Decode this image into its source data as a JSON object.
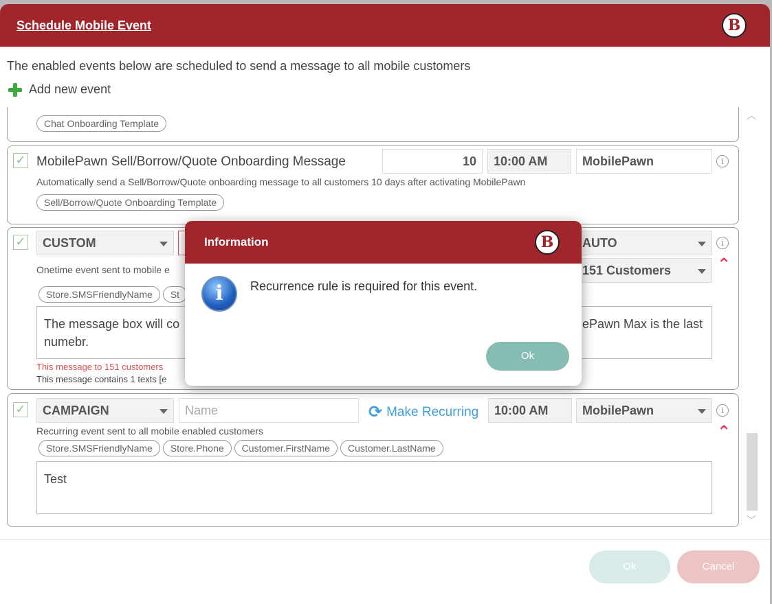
{
  "window": {
    "title": "Schedule Mobile Event",
    "intro": "The enabled events below are scheduled to send a message to all mobile customers",
    "add_new": "Add new event"
  },
  "colors": {
    "brand": "#a0262b",
    "ok_button": "#86bcb2",
    "add_icon": "#3daa3d",
    "delete_icon": "#e83a55",
    "warning_text": "#e05050"
  },
  "cards": {
    "chat": {
      "template": "Chat Onboarding Template"
    },
    "sell": {
      "name": "MobilePawn Sell/Borrow/Quote Onboarding Message",
      "days": "10",
      "time": "10:00 AM",
      "channel": "MobilePawn",
      "description": "Automatically send a Sell/Borrow/Quote onboarding message to all customers 10 days after activating MobilePawn",
      "template": "Sell/Borrow/Quote Onboarding Template"
    },
    "custom": {
      "type": "CUSTOM",
      "channel": "AUTO",
      "customers": "151 Customers",
      "description": "Onetime event sent to mobile e",
      "tags": [
        "Store.SMSFriendlyName",
        "St"
      ],
      "message_left": "The message box will co",
      "message_line2": "numebr.",
      "message_right": "ePawn Max is the last",
      "warning": "This message to 151 customers",
      "texts_info": "This message contains 1 texts [e"
    },
    "campaign": {
      "type": "CAMPAIGN",
      "name_placeholder": "Name",
      "make_recurring": "Make Recurring",
      "time": "10:00 AM",
      "channel": "MobilePawn",
      "description": "Recurring event sent to all mobile enabled customers",
      "tags": [
        "Store.SMSFriendlyName",
        "Store.Phone",
        "Customer.FirstName",
        "Customer.LastName"
      ],
      "message": "Test"
    }
  },
  "footer": {
    "ok": "Ok",
    "cancel": "Cancel"
  },
  "dialog": {
    "title": "Information",
    "message": "Recurrence rule is required for this event.",
    "ok": "Ok"
  },
  "icons": {
    "logo": "B",
    "info_glyph": "i",
    "delete_glyph": "⌃",
    "refresh_glyph": "⟳"
  }
}
